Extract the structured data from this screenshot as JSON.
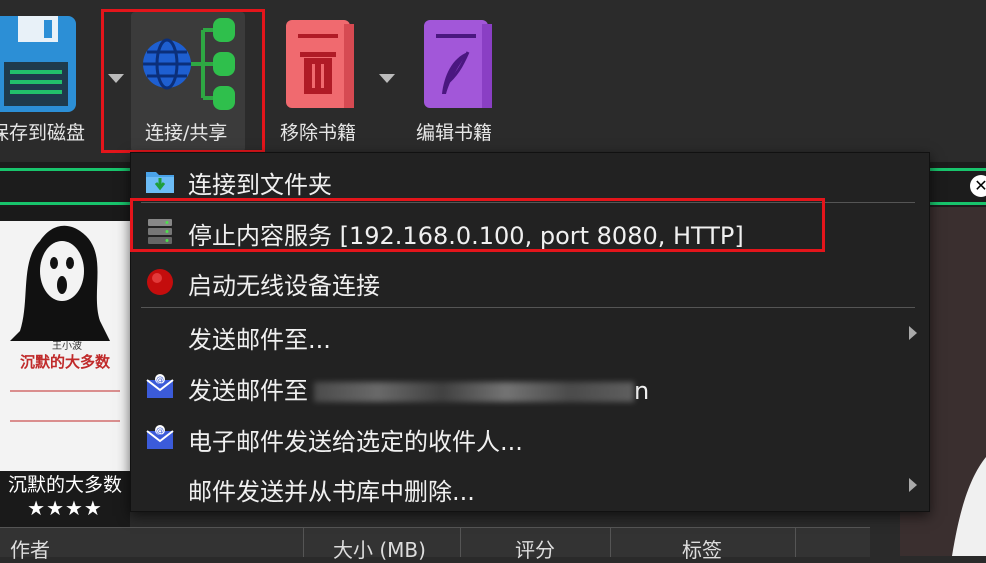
{
  "toolbar": {
    "save_label": "保存到磁盘",
    "connect_label": "连接/共享",
    "remove_label": "移除书籍",
    "edit_label": "编辑书籍"
  },
  "menu": {
    "items": [
      {
        "label": "连接到文件夹",
        "icon": "folder-download-icon"
      },
      {
        "label": "停止内容服务 [192.168.0.100, port 8080, HTTP]",
        "icon": "server-icon"
      },
      {
        "label": "启动无线设备连接",
        "icon": "red-dot-icon"
      },
      {
        "label": "发送邮件至...",
        "icon": ""
      },
      {
        "label": "发送邮件至",
        "suffix": "n",
        "icon": "email-icon"
      },
      {
        "label": "电子邮件发送给选定的收件人...",
        "icon": "email-icon"
      },
      {
        "label": "邮件发送并从书库中删除...",
        "icon": ""
      }
    ]
  },
  "book": {
    "author_cover": "王小波",
    "title_cover": "沉默的大多数",
    "title": "沉默的大多数",
    "rating": "★★★★"
  },
  "table": {
    "headers": [
      "作者",
      "大小 (MB)",
      "评分",
      "标签"
    ]
  },
  "colors": {
    "highlight": "#e4151b",
    "accent_green": "#18c46c"
  }
}
